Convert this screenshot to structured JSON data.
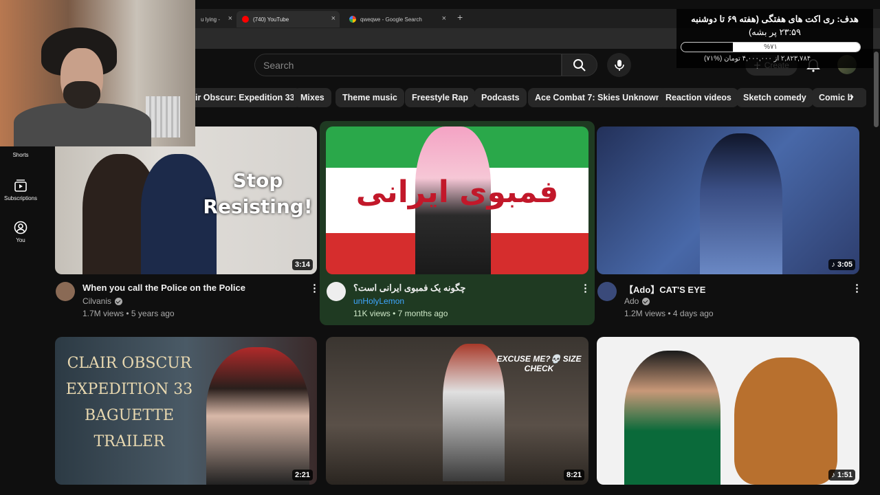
{
  "browser": {
    "tabs": [
      {
        "title": "u lying -",
        "active": false
      },
      {
        "title": "(740) YouTube",
        "active": true
      },
      {
        "title": "qweqwe - Google Search",
        "active": false
      }
    ],
    "new_tab": "+"
  },
  "overlay": {
    "title": "هدف: ری اکت های هفتگی (هفته ۶۹ تا دوشنبه",
    "time": "۲۳:۵۹ پر بشه)",
    "progress_label": "%۷۱",
    "progress_fraction": 0.71,
    "money": "۲,۸۲۳,۷۸۴ از ۴,۰۰۰,۰۰۰ تومان (%۷۱)"
  },
  "youtube": {
    "search_placeholder": "Search",
    "create_label": "Create",
    "chips": [
      "ir Obscur: Expedition 33",
      "Mixes",
      "Theme music",
      "Freestyle Rap",
      "Podcasts",
      "Ace Combat 7: Skies Unknown",
      "Reaction videos",
      "Sketch comedy",
      "Comic b"
    ],
    "sidebar": [
      {
        "label": "Shorts",
        "icon": "shorts-icon"
      },
      {
        "label": "Subscriptions",
        "icon": "subscriptions-icon"
      },
      {
        "label": "You",
        "icon": "you-icon"
      }
    ],
    "videos": [
      {
        "title": "When you call the Police on the Police",
        "channel": "Cilvanis",
        "verified": true,
        "meta": "1.7M views • 5 years ago",
        "duration": "3:14",
        "thumb_text": "Stop Resisting!"
      },
      {
        "title": "چگونه یک فمبوی ایرانی است؟",
        "channel": "unHolyLemon",
        "verified": false,
        "meta": "11K views • 7 months ago",
        "duration": "",
        "thumb_text": "فمبوی ایرانی"
      },
      {
        "title": "【Ado】CAT'S EYE",
        "channel": "Ado",
        "verified": true,
        "meta": "1.2M views • 4 days ago",
        "duration": "♪ 3:05",
        "thumb_text": ""
      },
      {
        "title": "",
        "channel": "",
        "verified": false,
        "meta": "",
        "duration": "2:21",
        "thumb_text": "CLAIR OBSCUR EXPEDITION 33 BAGUETTE TRAILER"
      },
      {
        "title": "",
        "channel": "",
        "verified": false,
        "meta": "",
        "duration": "8:21",
        "thumb_text": "EXCUSE ME?💀 SIZE CHECK"
      },
      {
        "title": "",
        "channel": "",
        "verified": false,
        "meta": "",
        "duration": "♪ 1:51",
        "thumb_text": ""
      }
    ]
  },
  "colors": {
    "bg": "#0f0f0f",
    "highlight": "#1f3a22",
    "chip": "#272727"
  }
}
